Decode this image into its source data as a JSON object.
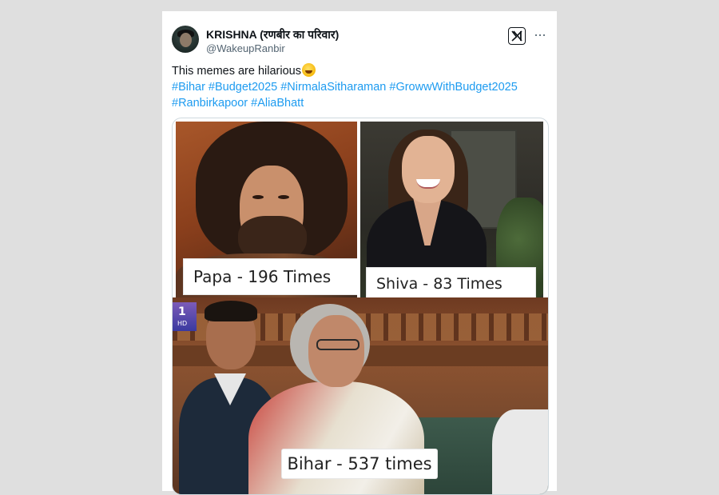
{
  "tweet": {
    "display_name": "KRISHNA (रणबीर का परिवार)",
    "handle": "@WakeupRanbir",
    "text": "This memes are hilarious",
    "emoji": "sweat-smile",
    "hashtags_line1": [
      "#Bihar",
      "#Budget2025",
      "#NirmalaSitharaman",
      "#GrowwWithBudget2025"
    ],
    "hashtags_line2": [
      "#Ranbirkapoor",
      "#AliaBhatt"
    ]
  },
  "media": {
    "panels": [
      {
        "caption": "Papa - 196 Times"
      },
      {
        "caption": "Shiva - 83 Times"
      },
      {
        "caption": "Bihar - 537 times",
        "channel_badge": "1",
        "channel_badge_sub": "HD"
      }
    ]
  },
  "icons": {
    "logo": "x-logo-icon",
    "more": "more-options-icon"
  }
}
